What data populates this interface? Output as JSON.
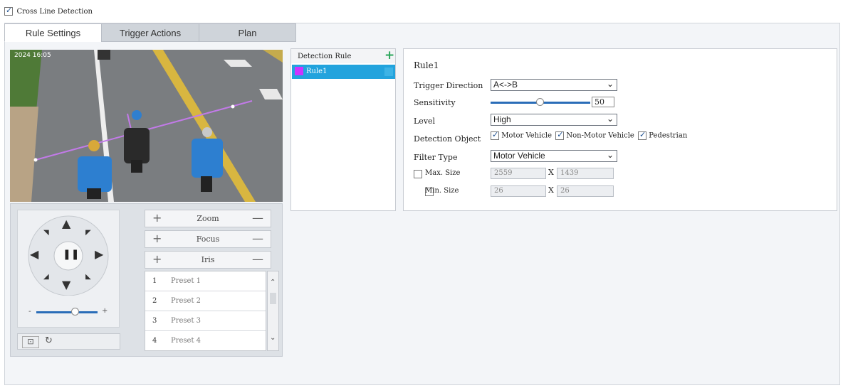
{
  "header": {
    "cross_line_label": "Cross Line Detection",
    "cross_line_checked": true
  },
  "tabs": [
    {
      "label": "Rule Settings",
      "active": true
    },
    {
      "label": "Trigger Actions",
      "active": false
    },
    {
      "label": "Plan",
      "active": false
    }
  ],
  "video": {
    "timestamp": "2024 16:05"
  },
  "ptz": {
    "zoom_label": "Zoom",
    "focus_label": "Focus",
    "iris_label": "Iris",
    "speed_minus": "-",
    "speed_plus": "+",
    "presets": [
      {
        "num": "1",
        "name": "Preset 1"
      },
      {
        "num": "2",
        "name": "Preset 2"
      },
      {
        "num": "3",
        "name": "Preset 3"
      },
      {
        "num": "4",
        "name": "Preset 4"
      }
    ]
  },
  "rules": {
    "title": "Detection Rule",
    "items": [
      {
        "name": "Rule1",
        "color": "#cc33ff"
      }
    ]
  },
  "settings": {
    "rule_name": "Rule1",
    "trigger_direction_label": "Trigger Direction",
    "trigger_direction_value": "A<->B",
    "sensitivity_label": "Sensitivity",
    "sensitivity_value": "50",
    "level_label": "Level",
    "level_value": "High",
    "detection_object_label": "Detection Object",
    "objects": [
      {
        "label": "Motor Vehicle",
        "checked": true
      },
      {
        "label": "Non-Motor Vehicle",
        "checked": true
      },
      {
        "label": "Pedestrian",
        "checked": true
      }
    ],
    "filter_type_label": "Filter Type",
    "filter_type_value": "Motor Vehicle",
    "max_size_label": "Max. Size",
    "max_w": "2559",
    "max_h": "1439",
    "min_size_label": "Min. Size",
    "min_w": "26",
    "min_h": "26",
    "x_sep": "X"
  },
  "colors": {
    "accent": "#1a9ed8",
    "rule_color": "#cc33ff",
    "add_icon": "#2aa65a"
  }
}
